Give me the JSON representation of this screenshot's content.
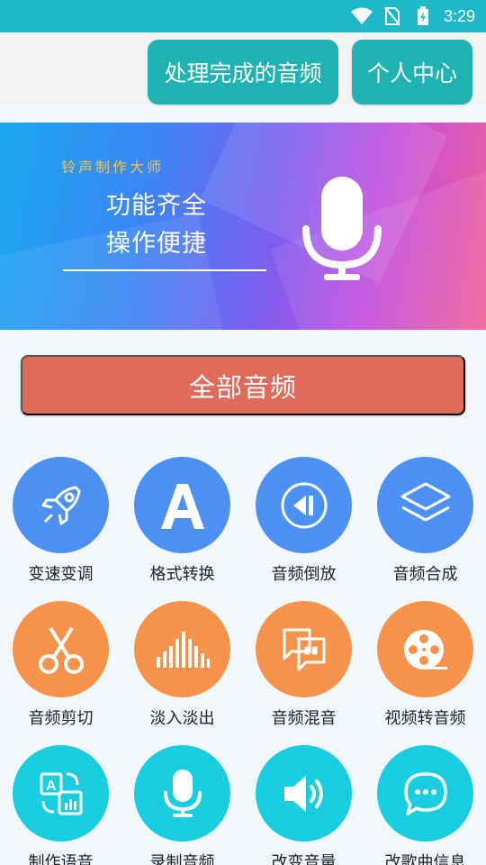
{
  "status_bar": {
    "time": "3:29"
  },
  "top_bar": {
    "processed_label": "处理完成的音频",
    "personal_label": "个人中心"
  },
  "banner": {
    "subtitle": "铃声制作大师",
    "line1": "功能齐全",
    "line2": "操作便捷"
  },
  "all_audio_label": "全部音频",
  "tools": [
    {
      "label": "变速变调",
      "icon": "rocket-icon",
      "color": "#4d90f3"
    },
    {
      "label": "格式转换",
      "icon": "letter-a-icon",
      "color": "#4d90f3"
    },
    {
      "label": "音频倒放",
      "icon": "rewind-icon",
      "color": "#4d90f3"
    },
    {
      "label": "音频合成",
      "icon": "layers-icon",
      "color": "#4d90f3"
    },
    {
      "label": "音频剪切",
      "icon": "scissors-icon",
      "color": "#f7924a"
    },
    {
      "label": "淡入淡出",
      "icon": "sound-bars-icon",
      "color": "#f7924a"
    },
    {
      "label": "音频混音",
      "icon": "mix-chat-icon",
      "color": "#f7924a"
    },
    {
      "label": "视频转音频",
      "icon": "film-reel-icon",
      "color": "#f7924a"
    },
    {
      "label": "制作语音",
      "icon": "translate-icon",
      "color": "#19cde0"
    },
    {
      "label": "录制音频",
      "icon": "microphone-icon",
      "color": "#19cde0"
    },
    {
      "label": "改变音量",
      "icon": "speaker-icon",
      "color": "#19cde0"
    },
    {
      "label": "改歌曲信息",
      "icon": "chat-bubble-icon",
      "color": "#19cde0"
    }
  ]
}
